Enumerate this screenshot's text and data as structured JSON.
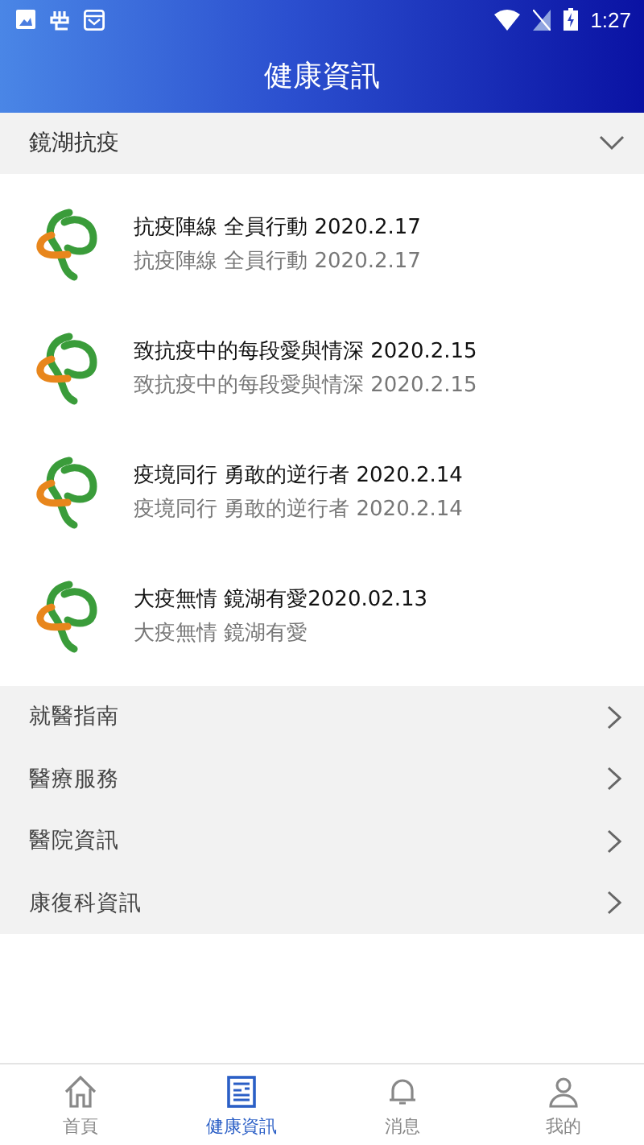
{
  "status_bar": {
    "time": "1:27"
  },
  "header": {
    "title": "健康資訊"
  },
  "section": {
    "title": "鏡湖抗疫",
    "expanded": true,
    "articles": [
      {
        "title": "抗疫陣線 全員行動 2020.2.17",
        "subtitle": "抗疫陣線 全員行動 2020.2.17"
      },
      {
        "title": "致抗疫中的每段愛與情深 2020.2.15",
        "subtitle": "致抗疫中的每段愛與情深 2020.2.15"
      },
      {
        "title": "疫境同行 勇敢的逆行者 2020.2.14",
        "subtitle": "疫境同行 勇敢的逆行者 2020.2.14"
      },
      {
        "title": "大疫無情 鏡湖有愛2020.02.13",
        "subtitle": "大疫無情 鏡湖有愛"
      }
    ]
  },
  "menu": [
    {
      "label": "就醫指南"
    },
    {
      "label": "醫療服務"
    },
    {
      "label": "醫院資訊"
    },
    {
      "label": "康復科資訊"
    }
  ],
  "bottom_nav": [
    {
      "kind": "home",
      "label": "首頁",
      "selected": false
    },
    {
      "kind": "news",
      "label": "健康資訊",
      "selected": true
    },
    {
      "kind": "bell",
      "label": "消息",
      "selected": false
    },
    {
      "kind": "person",
      "label": "我的",
      "selected": false
    }
  ]
}
